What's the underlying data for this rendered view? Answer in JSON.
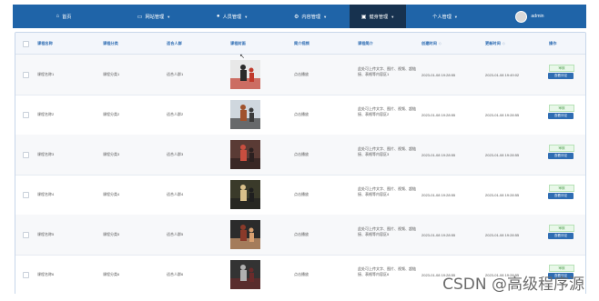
{
  "nav": {
    "items": [
      {
        "label": "首页",
        "icon": "home-icon",
        "glyph": "⌂",
        "dropdown": false
      },
      {
        "label": "网站管理",
        "icon": "monitor-icon",
        "glyph": "▭",
        "dropdown": true
      },
      {
        "label": "人员管理",
        "icon": "user-icon",
        "glyph": "👤",
        "dropdown": true
      },
      {
        "label": "内容管理",
        "icon": "gear-icon",
        "glyph": "⚙",
        "dropdown": true
      },
      {
        "label": "健身管理",
        "icon": "dumbbell-icon",
        "glyph": "▣",
        "dropdown": true,
        "active": true
      },
      {
        "label": "个人管理",
        "icon": "person-icon",
        "glyph": "",
        "dropdown": true
      }
    ],
    "user": "admin",
    "colors": {
      "bar": "#1f64a8",
      "active": "#17324f"
    }
  },
  "table": {
    "headers": [
      "课程名称",
      "课程分类",
      "适合人群",
      "课程封面",
      "简介视频",
      "课程简介",
      "创建时间",
      "更新时间",
      "操作"
    ],
    "sort_mark": "◇",
    "rows": [
      {
        "name": "课程名称1",
        "category": "课程分类1",
        "audience": "适合人群1",
        "video": "点击播放",
        "intro": "此处可上传文字、图片、视频、超链接、表格等内容区1",
        "created": "2023-01-08 19:28:55",
        "updated": "2023-01-08 19:49:02",
        "status": "审核",
        "action": "查看评论",
        "thumb": "thumb-1"
      },
      {
        "name": "课程名称2",
        "category": "课程分类2",
        "audience": "适合人群2",
        "video": "点击播放",
        "intro": "此处可上传文字、图片、视频、超链接、表格等内容区2",
        "created": "2023-01-08 19:28:55",
        "updated": "2023-01-08 19:28:55",
        "status": "审核",
        "action": "查看评论",
        "thumb": "thumb-2"
      },
      {
        "name": "课程名称3",
        "category": "课程分类3",
        "audience": "适合人群3",
        "video": "点击播放",
        "intro": "此处可上传文字、图片、视频、超链接、表格等内容区3",
        "created": "2023-01-08 19:28:55",
        "updated": "2023-01-08 19:28:55",
        "status": "审核",
        "action": "查看评论",
        "thumb": "thumb-3"
      },
      {
        "name": "课程名称4",
        "category": "课程分类4",
        "audience": "适合人群4",
        "video": "点击播放",
        "intro": "此处可上传文字、图片、视频、超链接、表格等内容区4",
        "created": "2023-01-08 19:28:55",
        "updated": "2023-01-08 19:28:55",
        "status": "审核",
        "action": "查看评论",
        "thumb": "thumb-4"
      },
      {
        "name": "课程名称5",
        "category": "课程分类5",
        "audience": "适合人群5",
        "video": "点击播放",
        "intro": "此处可上传文字、图片、视频、超链接、表格等内容区5",
        "created": "2023-01-08 19:28:55",
        "updated": "2023-01-08 19:28:55",
        "status": "审核",
        "action": "查看评论",
        "thumb": "thumb-5"
      },
      {
        "name": "课程名称6",
        "category": "课程分类6",
        "audience": "适合人群6",
        "video": "点击播放",
        "intro": "此处可上传文字、图片、视频、超链接、表格等内容区6",
        "created": "2023-01-08 19:28:55",
        "updated": "2023-01-08 19:28:55",
        "status": "审核",
        "action": "查看评论",
        "thumb": "thumb-6"
      }
    ]
  },
  "watermark": "CSDN @高级程序源"
}
